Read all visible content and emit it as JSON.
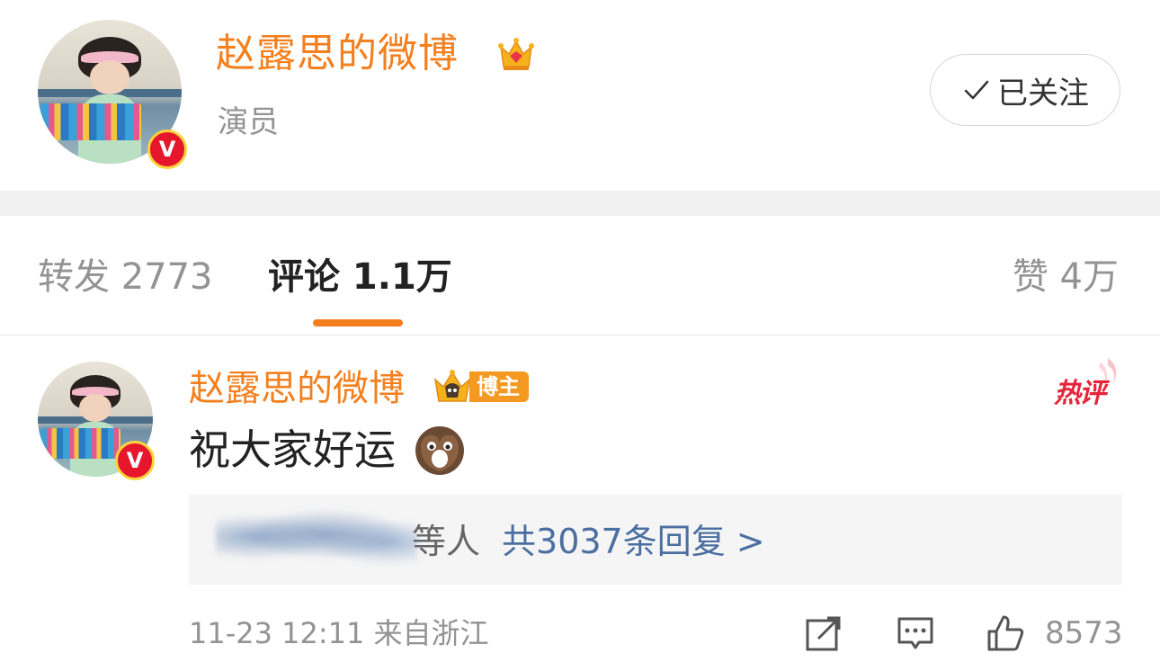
{
  "profile": {
    "name": "赵露思的微博",
    "description": "演员",
    "follow_label": "已关注"
  },
  "tabs": [
    {
      "label": "转发 2773"
    },
    {
      "label": "评论 1.1万"
    },
    {
      "label": "赞 4万"
    }
  ],
  "comment": {
    "author": "赵露思的微博",
    "badge_label": "博主",
    "hot_label": "热评",
    "text": "祝大家好运",
    "reply_suffix": "等人",
    "reply_link": "共3037条回复 >",
    "meta": "11-23 12:11 来自浙江",
    "like_count": "8573"
  },
  "colors": {
    "accent": "#f37f1d",
    "link": "#4a6fa0",
    "muted": "#939393",
    "hot": "#e6243a"
  },
  "icons": [
    "crown-icon",
    "check-icon",
    "verified-v-icon",
    "blogger-crown-icon",
    "emoji-icon",
    "share-icon",
    "comment-icon",
    "like-icon"
  ]
}
